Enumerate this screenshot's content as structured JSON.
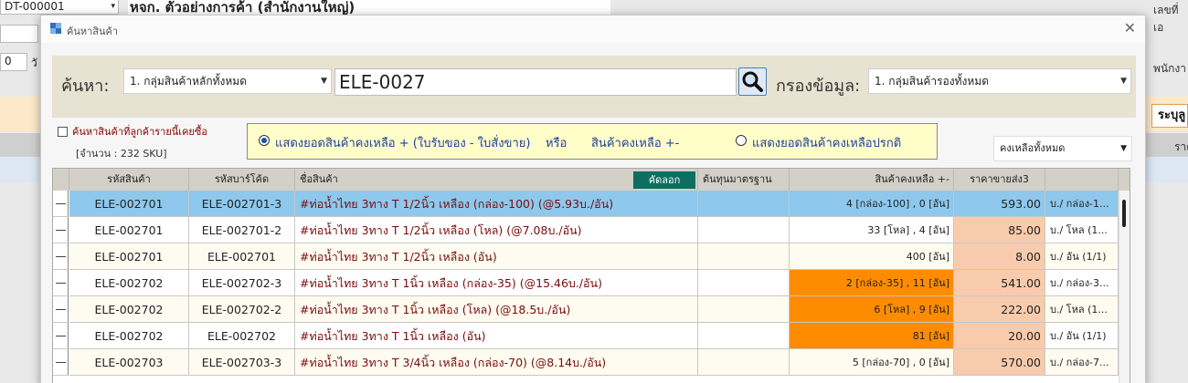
{
  "background": {
    "doc_no": "DT-000001",
    "company_title": "หจก. ตัวอย่างการค้า (สำนักงานใหญ่)",
    "days_value": "0",
    "days_label": "วั",
    "right_label_1": "เลขที่เอ",
    "right_label_2": "พนักงา",
    "right_label_3": "ระบุลู",
    "right_label_4": "ราค"
  },
  "dialog": {
    "title": "ค้นหาสินค้า",
    "close_symbol": "✕",
    "search_label": "ค้นหา:",
    "main_group_combo": "1. กลุ่มสินค้าหลักทั้งหมด",
    "search_value": "ELE-0027",
    "filter_label": "กรองข้อมูล:",
    "sub_group_combo": "1. กลุ่มสินค้ารองทั้งหมด",
    "by_customer_checkbox": "ค้นหาสินค้าที่ลูกค้ารายนี้เคยซื้อ",
    "sku_count": "[จำนวน : 232 SKU]",
    "option_1": "แสดงยอดสินค้าคงเหลือ + (ใบรับของ - ใบสั่งขาย)",
    "option_or": "หรือ",
    "option_1b": "สินค้าคงเหลือ +-",
    "option_2": "แสดงยอดสินค้าคงเหลือปรกติ",
    "stock_combo": "คงเหลือทั้งหมด",
    "copy_button": "คัดลอก"
  },
  "table": {
    "columns": [
      "รหัสสินค้า",
      "รหัสบาร์โค้ด",
      "ชื่อสินค้า",
      "ต้นทุนมาตรฐาน",
      "สินค้าคงเหลือ +-",
      "ราคาขายส่ง3",
      ""
    ],
    "rows": [
      {
        "code": "ELE-002701",
        "barcode": "ELE-002701-3",
        "name": "#ท่อน้ำไทย 3ทาง T 1/2นิ้ว เหลือง (กล่อง-100) (@5.93บ./อัน)",
        "cost": "",
        "stock": "4 [กล่อง-100] , 0 [อัน]",
        "price": "593.00",
        "unit": "บ./ กล่อง-1..."
      },
      {
        "code": "ELE-002701",
        "barcode": "ELE-002701-2",
        "name": "#ท่อน้ำไทย 3ทาง T 1/2นิ้ว เหลือง (โหล) (@7.08บ./อัน)",
        "cost": "",
        "stock": "33 [โหล] , 4 [อัน]",
        "price": "85.00",
        "unit": "บ./ โหล (1..."
      },
      {
        "code": "ELE-002701",
        "barcode": "ELE-002701",
        "name": "#ท่อน้ำไทย 3ทาง T 1/2นิ้ว เหลือง (อัน)",
        "cost": "",
        "stock": "400 [อัน]",
        "price": "8.00",
        "unit": "บ./ อัน (1/1)"
      },
      {
        "code": "ELE-002702",
        "barcode": "ELE-002702-3",
        "name": "#ท่อน้ำไทย 3ทาง T 1นิ้ว เหลือง (กล่อง-35) (@15.46บ./อัน)",
        "cost": "",
        "stock": "2 [กล่อง-35] , 11 [อัน]",
        "price": "541.00",
        "unit": "บ./ กล่อง-3..."
      },
      {
        "code": "ELE-002702",
        "barcode": "ELE-002702-2",
        "name": "#ท่อน้ำไทย 3ทาง T 1นิ้ว เหลือง (โหล) (@18.5บ./อัน)",
        "cost": "",
        "stock": "6 [โหล] , 9 [อัน]",
        "price": "222.00",
        "unit": "บ./ โหล (1..."
      },
      {
        "code": "ELE-002702",
        "barcode": "ELE-002702",
        "name": "#ท่อน้ำไทย 3ทาง T 1นิ้ว เหลือง (อัน)",
        "cost": "",
        "stock": "81 [อัน]",
        "price": "20.00",
        "unit": "บ./ อัน (1/1)"
      },
      {
        "code": "ELE-002703",
        "barcode": "ELE-002703-3",
        "name": "#ท่อน้ำไทย 3ทาง T 3/4นิ้ว เหลือง (กล่อง-70) (@8.14บ./อัน)",
        "cost": "",
        "stock": "5 [กล่อง-70] , 0 [อัน]",
        "price": "570.00",
        "unit": "บ./ กล่อง-7..."
      }
    ]
  },
  "colors": {
    "selected_row": "#8ec8ec",
    "cream_row": "#fefcf0",
    "low_stock": "#ff8c00",
    "price_cell": "#f8cbad",
    "copy_button": "#0e6e5f"
  }
}
